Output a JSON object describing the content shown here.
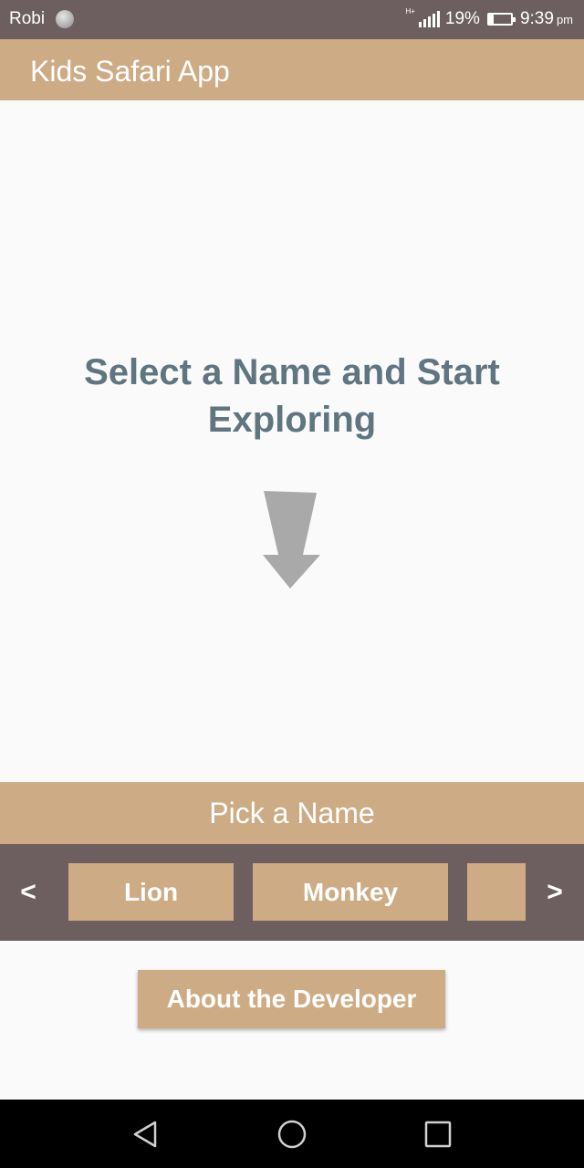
{
  "status_bar": {
    "carrier": "Robi",
    "battery_percent": "19%",
    "battery_level": 0.19,
    "time": "9:39",
    "ampm": "pm"
  },
  "app_bar": {
    "title": "Kids Safari App"
  },
  "main": {
    "headline": "Select a Name and Start Exploring",
    "arrow_icon": "down-arrow-icon"
  },
  "picker": {
    "header": "Pick a Name",
    "prev_label": "<",
    "next_label": ">",
    "names": [
      "Lion",
      "Monkey",
      ""
    ]
  },
  "about_button": {
    "label": "About the Developer"
  },
  "colors": {
    "accent_tan": "#cdac85",
    "bar_brown": "#6d5f5f",
    "headline_slate": "#5f7580",
    "arrow_gray": "#a9a9a9"
  }
}
